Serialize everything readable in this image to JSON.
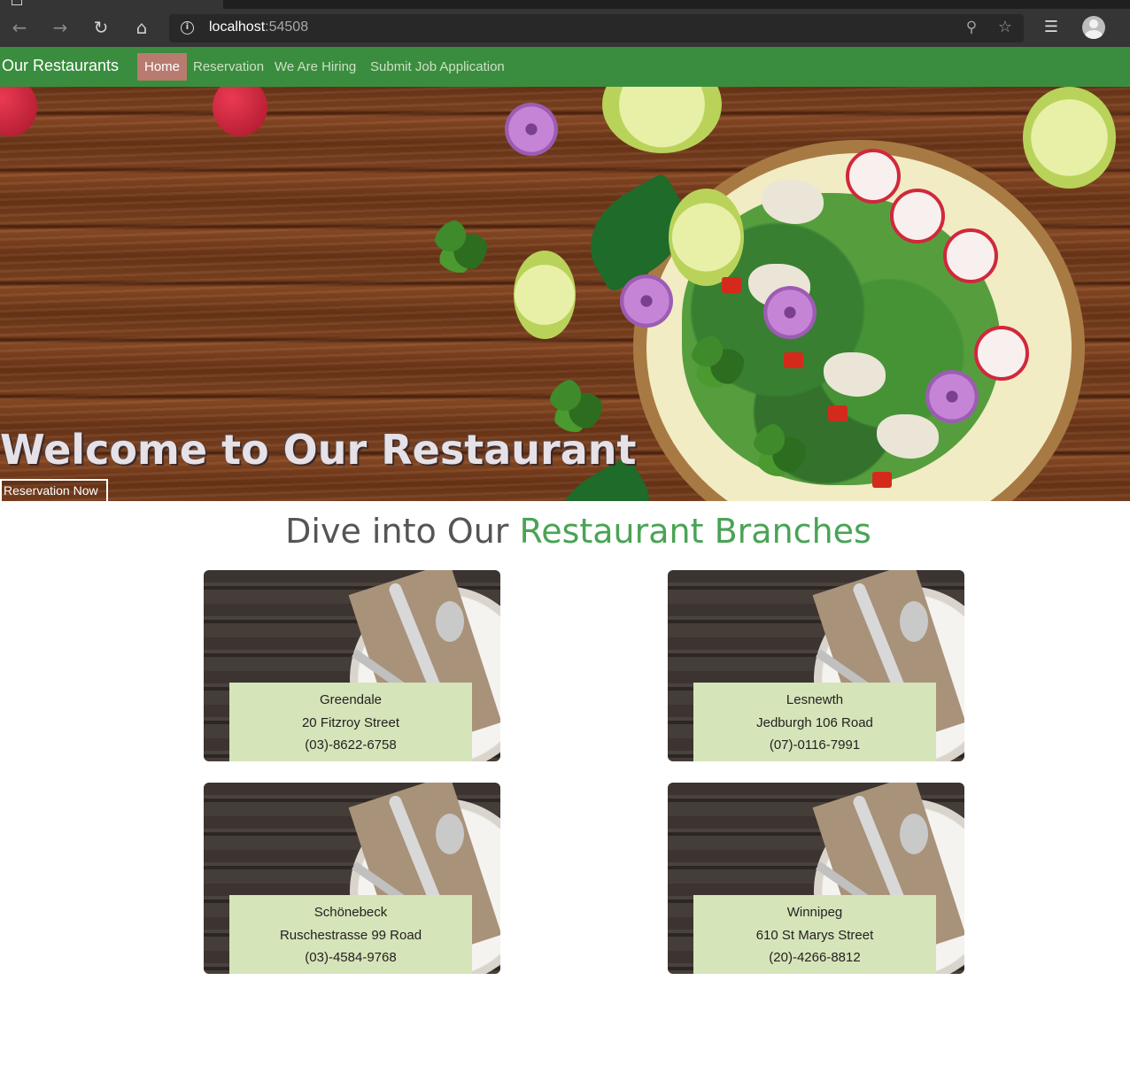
{
  "browser": {
    "url_host": "localhost",
    "url_port": ":54508"
  },
  "site": {
    "brand": "Our Restaurants",
    "nav": [
      {
        "label": "Home",
        "active": true
      },
      {
        "label": "Reservation",
        "active": false
      },
      {
        "label": "We Are Hiring",
        "active": false
      },
      {
        "label": "Submit Job Application",
        "active": false
      }
    ],
    "nav_color": "#3a8d3e",
    "active_color": "#b97b70"
  },
  "hero": {
    "title": "Welcome to Our Restaurant",
    "button": "Reservation Now"
  },
  "branches": {
    "title_part1": "Dive into Our ",
    "title_part2": "Restaurant Branches",
    "accent_color": "#4aa356",
    "items": [
      {
        "name": "Greendale",
        "address": "20 Fitzroy Street",
        "phone": "(03)-8622-6758"
      },
      {
        "name": "Lesnewth",
        "address": "Jedburgh 106 Road",
        "phone": "(07)-0116-7991"
      },
      {
        "name": "Schönebeck",
        "address": "Ruschestrasse 99 Road",
        "phone": "(03)-4584-9768"
      },
      {
        "name": "Winnipeg",
        "address": "610 St Marys Street",
        "phone": "(20)-4266-8812"
      }
    ]
  }
}
